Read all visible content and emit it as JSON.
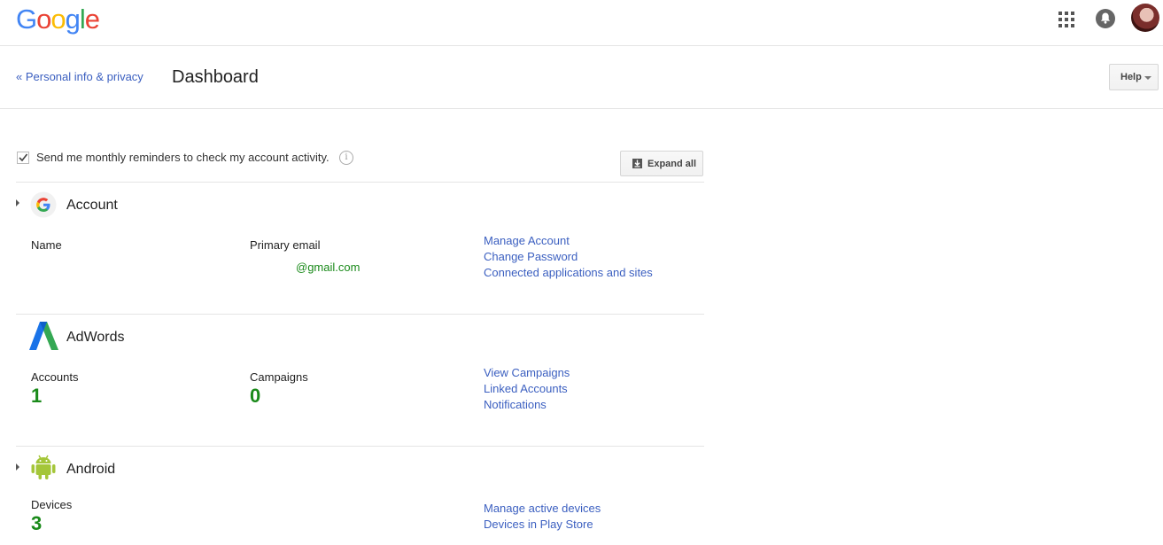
{
  "header": {
    "logo_letters": [
      "G",
      "o",
      "o",
      "g",
      "l",
      "e"
    ],
    "apps_icon": "apps-grid-icon",
    "notifications_icon": "bell-icon",
    "avatar": "user-avatar"
  },
  "subheader": {
    "back_link": "« Personal info & privacy",
    "title": "Dashboard",
    "help_button": "Help"
  },
  "reminder": {
    "checked": true,
    "label": "Send me monthly reminders to check my account activity.",
    "info_icon": "info-icon"
  },
  "expand_all": "Expand all",
  "sections": {
    "account": {
      "name": "Account",
      "icon": "google-g-icon",
      "fields": {
        "name_label": "Name",
        "email_label": "Primary email",
        "email_value": "@gmail.com"
      },
      "links": [
        "Manage Account",
        "Change Password",
        "Connected applications and sites"
      ]
    },
    "adwords": {
      "name": "AdWords",
      "icon": "adwords-icon",
      "stats": {
        "accounts_label": "Accounts",
        "accounts_value": "1",
        "campaigns_label": "Campaigns",
        "campaigns_value": "0"
      },
      "links": [
        "View Campaigns",
        "Linked Accounts",
        "Notifications"
      ]
    },
    "android": {
      "name": "Android",
      "icon": "android-icon",
      "stats": {
        "devices_label": "Devices",
        "devices_value": "3"
      },
      "links": [
        "Manage active devices",
        "Devices in Play Store"
      ]
    }
  },
  "colors": {
    "link": "#3b5fc0",
    "value_green": "#1a8a1a",
    "divider": "#e5e5e5"
  }
}
